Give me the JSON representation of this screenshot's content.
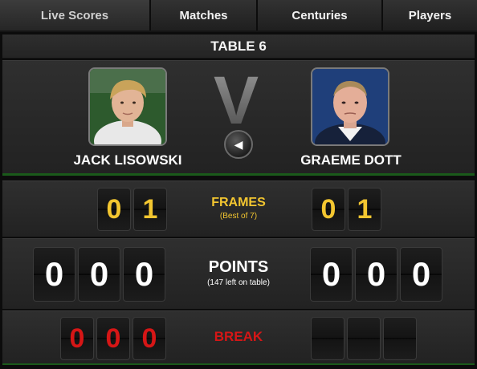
{
  "nav": {
    "tabs": [
      {
        "label": "Live Scores"
      },
      {
        "label": "Matches"
      },
      {
        "label": "Centuries"
      },
      {
        "label": "Players"
      }
    ]
  },
  "table": {
    "title": "TABLE 6"
  },
  "vs_letter": "V",
  "players": {
    "left": {
      "name": "JACK LISOWSKI"
    },
    "right": {
      "name": "GRAEME DOTT"
    }
  },
  "frames": {
    "label": "FRAMES",
    "sub": "(Best of 7)",
    "left": [
      "0",
      "1"
    ],
    "right": [
      "0",
      "1"
    ]
  },
  "points": {
    "label": "POINTS",
    "sub": "(147 left on table)",
    "left": [
      "0",
      "0",
      "0"
    ],
    "right": [
      "0",
      "0",
      "0"
    ]
  },
  "break": {
    "label": "BREAK",
    "left": [
      "0",
      "0",
      "0"
    ],
    "right": [
      "",
      "",
      ""
    ]
  },
  "colors": {
    "accent_yellow": "#f3c630",
    "break_red": "#d61616"
  },
  "icons": {
    "back": "left-arrow-icon"
  }
}
